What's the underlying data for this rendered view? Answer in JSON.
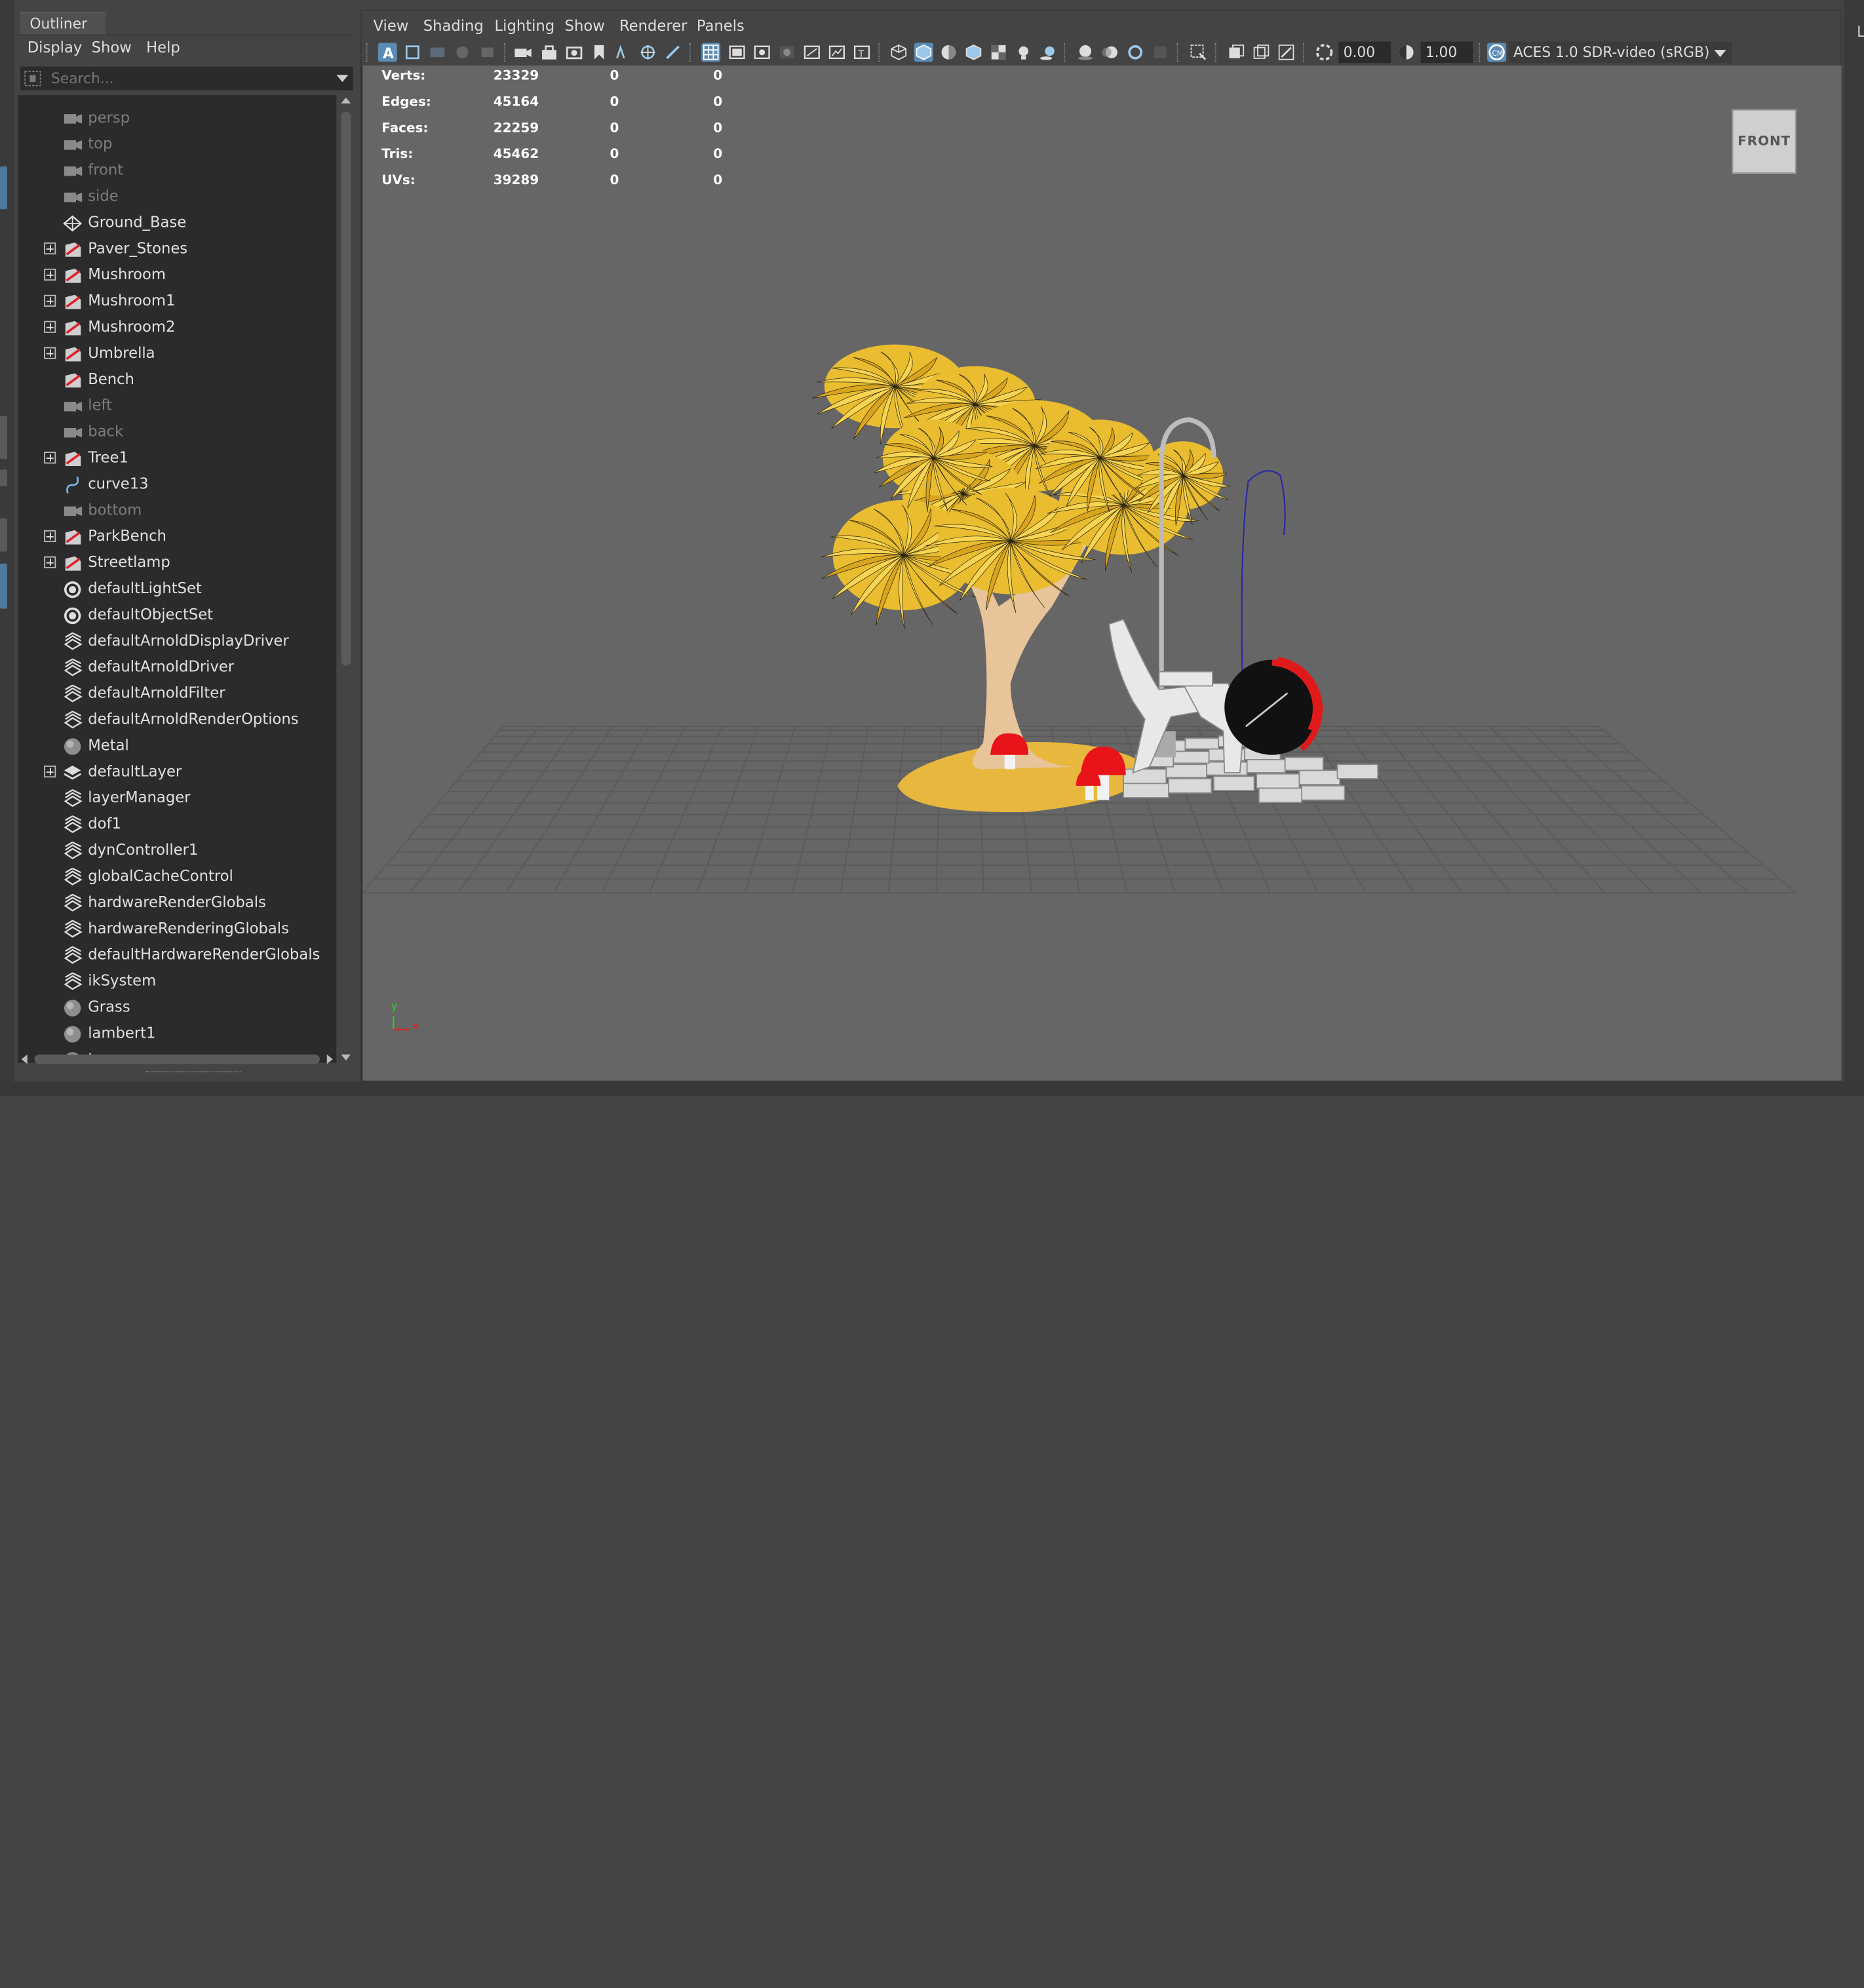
{
  "outliner": {
    "tab_label": "Outliner",
    "menu": [
      "Display",
      "Show",
      "Help"
    ],
    "search_placeholder": "Search...",
    "items": [
      {
        "name": "persp",
        "icon": "camera-icon",
        "expandable": false,
        "dim": true
      },
      {
        "name": "top",
        "icon": "camera-icon",
        "expandable": false,
        "dim": true
      },
      {
        "name": "front",
        "icon": "camera-icon",
        "expandable": false,
        "dim": true
      },
      {
        "name": "side",
        "icon": "camera-icon",
        "expandable": false,
        "dim": true
      },
      {
        "name": "Ground_Base",
        "icon": "mesh-icon",
        "expandable": false,
        "dim": false
      },
      {
        "name": "Paver_Stones",
        "icon": "transform-icon",
        "expandable": true,
        "dim": false
      },
      {
        "name": "Mushroom",
        "icon": "transform-icon",
        "expandable": true,
        "dim": false
      },
      {
        "name": "Mushroom1",
        "icon": "transform-icon",
        "expandable": true,
        "dim": false
      },
      {
        "name": "Mushroom2",
        "icon": "transform-icon",
        "expandable": true,
        "dim": false
      },
      {
        "name": "Umbrella",
        "icon": "transform-icon",
        "expandable": true,
        "dim": false
      },
      {
        "name": "Bench",
        "icon": "transform-icon",
        "expandable": false,
        "dim": false
      },
      {
        "name": "left",
        "icon": "camera-icon",
        "expandable": false,
        "dim": true
      },
      {
        "name": "back",
        "icon": "camera-icon",
        "expandable": false,
        "dim": true
      },
      {
        "name": "Tree1",
        "icon": "transform-icon",
        "expandable": true,
        "dim": false
      },
      {
        "name": "curve13",
        "icon": "curve-icon",
        "expandable": false,
        "dim": false
      },
      {
        "name": "bottom",
        "icon": "camera-icon",
        "expandable": false,
        "dim": true
      },
      {
        "name": "ParkBench",
        "icon": "transform-icon",
        "expandable": true,
        "dim": false
      },
      {
        "name": "Streetlamp",
        "icon": "transform-icon",
        "expandable": true,
        "dim": false
      },
      {
        "name": "defaultLightSet",
        "icon": "set-icon",
        "expandable": false,
        "dim": false
      },
      {
        "name": "defaultObjectSet",
        "icon": "set-icon",
        "expandable": false,
        "dim": false
      },
      {
        "name": "defaultArnoldDisplayDriver",
        "icon": "node-icon",
        "expandable": false,
        "dim": false
      },
      {
        "name": "defaultArnoldDriver",
        "icon": "node-icon",
        "expandable": false,
        "dim": false
      },
      {
        "name": "defaultArnoldFilter",
        "icon": "node-icon",
        "expandable": false,
        "dim": false
      },
      {
        "name": "defaultArnoldRenderOptions",
        "icon": "node-icon",
        "expandable": false,
        "dim": false
      },
      {
        "name": "Metal",
        "icon": "material-icon",
        "expandable": false,
        "dim": false
      },
      {
        "name": "defaultLayer",
        "icon": "layer-icon",
        "expandable": true,
        "dim": false
      },
      {
        "name": "layerManager",
        "icon": "node-icon",
        "expandable": false,
        "dim": false
      },
      {
        "name": "dof1",
        "icon": "node-icon",
        "expandable": false,
        "dim": false
      },
      {
        "name": "dynController1",
        "icon": "node-icon",
        "expandable": false,
        "dim": false
      },
      {
        "name": "globalCacheControl",
        "icon": "node-icon",
        "expandable": false,
        "dim": false
      },
      {
        "name": "hardwareRenderGlobals",
        "icon": "node-icon",
        "expandable": false,
        "dim": false
      },
      {
        "name": "hardwareRenderingGlobals",
        "icon": "node-icon",
        "expandable": false,
        "dim": false
      },
      {
        "name": "defaultHardwareRenderGlobals",
        "icon": "node-icon",
        "expandable": false,
        "dim": false
      },
      {
        "name": "ikSystem",
        "icon": "node-icon",
        "expandable": false,
        "dim": false
      },
      {
        "name": "Grass",
        "icon": "material-icon",
        "expandable": false,
        "dim": false
      },
      {
        "name": "lambert1",
        "icon": "material-icon",
        "expandable": false,
        "dim": false
      },
      {
        "name": "Leaves",
        "icon": "material-icon",
        "expandable": false,
        "dim": false
      }
    ]
  },
  "viewport": {
    "menu": [
      "View",
      "Shading",
      "Lighting",
      "Show",
      "Renderer",
      "Panels"
    ],
    "exposure": "0.00",
    "gamma": "1.00",
    "color_space": "ACES 1.0 SDR-video (sRGB)",
    "view_cube_label": "FRONT",
    "hud": [
      {
        "label": "Verts:",
        "values": [
          "23329",
          "0",
          "0"
        ]
      },
      {
        "label": "Edges:",
        "values": [
          "45164",
          "0",
          "0"
        ]
      },
      {
        "label": "Faces:",
        "values": [
          "22259",
          "0",
          "0"
        ]
      },
      {
        "label": "Tris:",
        "values": [
          "45462",
          "0",
          "0"
        ]
      },
      {
        "label": "UVs:",
        "values": [
          "39289",
          "0",
          "0"
        ]
      }
    ],
    "axis_labels": {
      "y": "y",
      "x": "x"
    }
  },
  "right_panel_label": "L",
  "colors": {
    "viewport_bg": "#666666",
    "panel_bg": "#444444",
    "list_bg": "#2b2b2b",
    "accent": "#5a8bb5",
    "leaves": "#f4c93a",
    "trunk": "#e8c49a",
    "mushroom_cap": "#e8141a",
    "umbrella": "#e01a1a"
  }
}
